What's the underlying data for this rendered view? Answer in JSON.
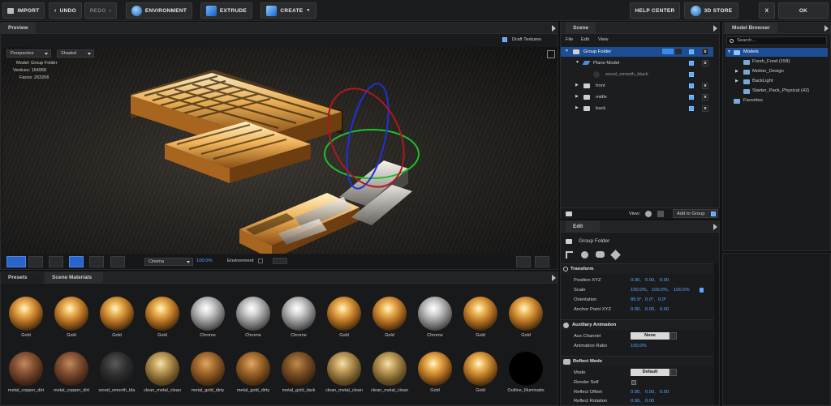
{
  "toolbar": {
    "import": "IMPORT",
    "undo": "UNDO",
    "redo": "REDO",
    "environment": "ENVIRONMENT",
    "extrude": "EXTRUDE",
    "create": "CREATE",
    "help_center": "HELP CENTER",
    "store": "3D STORE",
    "close": "X",
    "ok": "OK"
  },
  "preview": {
    "tab": "Preview",
    "draft_textures": "Draft Textures",
    "camera": "Perspective",
    "shading": "Shaded",
    "model_label": "Model:",
    "model_value": "Group Folder",
    "vertices_label": "Vertices:",
    "vertices_value": "194958",
    "faces_label": "Faces:",
    "faces_value": "263206",
    "render_mode": "Cinema",
    "zoom": "100.0%",
    "environment_label": "Environment"
  },
  "scene": {
    "title": "Scene",
    "menu": [
      "File",
      "Edit",
      "View"
    ],
    "items": [
      {
        "label": "Group Folder"
      },
      {
        "label": "Plane Model"
      },
      {
        "label": "wood_smooth_black"
      },
      {
        "label": "front"
      },
      {
        "label": "midle"
      },
      {
        "label": "back"
      }
    ],
    "view_label": "View:",
    "add_to_group": "Add to Group"
  },
  "model_browser": {
    "title": "Model Browser",
    "search_placeholder": "Search...",
    "items": [
      {
        "label": "Models"
      },
      {
        "label": "Fresh_Food (158)"
      },
      {
        "label": "Motion_Design"
      },
      {
        "label": "BackLight"
      },
      {
        "label": "Starter_Pack_Physical (42)"
      },
      {
        "label": "Favorites"
      }
    ]
  },
  "edit": {
    "tab": "Edit",
    "object": "Group Folder",
    "transform": {
      "title": "Transform",
      "position_label": "Position XYZ",
      "position": [
        "0.00,",
        "0.00,",
        "0.00"
      ],
      "scale_label": "Scale",
      "scale": [
        "100.0%,",
        "100.0%,",
        "100.0%"
      ],
      "orientation_label": "Orientation",
      "orientation": [
        "85.9°,",
        "0.0°,",
        "0.0°"
      ],
      "anchor_label": "Anchor Point XYZ",
      "anchor": [
        "0.00,",
        "0.00,",
        "0.00"
      ]
    },
    "aux": {
      "title": "Auxiliary Animation",
      "channel_label": "Aux Channel",
      "channel_value": "None",
      "ratio_label": "Animation Ratio",
      "ratio_value": "100.0%"
    },
    "reflect": {
      "title": "Reflect Mode",
      "mode_label": "Mode",
      "mode_value": "Default",
      "render_self_label": "Render Self",
      "offset_label": "Reflect Offset",
      "offset": [
        "0.00,",
        "0.00,",
        "0.00"
      ],
      "rotation_label": "Reflect Rotation",
      "rotation": [
        "0.00,",
        "0.00"
      ]
    }
  },
  "materials": {
    "tabs": [
      "Presets",
      "Scene Materials"
    ],
    "row1": [
      "Gold",
      "Gold",
      "Gold",
      "Gold",
      "Chrome",
      "Chrome",
      "Chrome",
      "Gold",
      "Gold",
      "Chrome",
      "Gold",
      "Gold"
    ],
    "row2": [
      "metal_copper_dirt",
      "metal_copper_dirt",
      "wood_smooth_bla",
      "clean_metal_clean",
      "metal_gold_dirty",
      "metal_gold_dirty",
      "metal_gold_dark",
      "clean_metal_clean",
      "clean_metal_clean",
      "Gold",
      "Gold",
      "Outline_Illuminatio"
    ]
  },
  "colors": {
    "accent": "#5aa8ff",
    "selection": "#1d4e95",
    "gold": "#e3a24a"
  }
}
